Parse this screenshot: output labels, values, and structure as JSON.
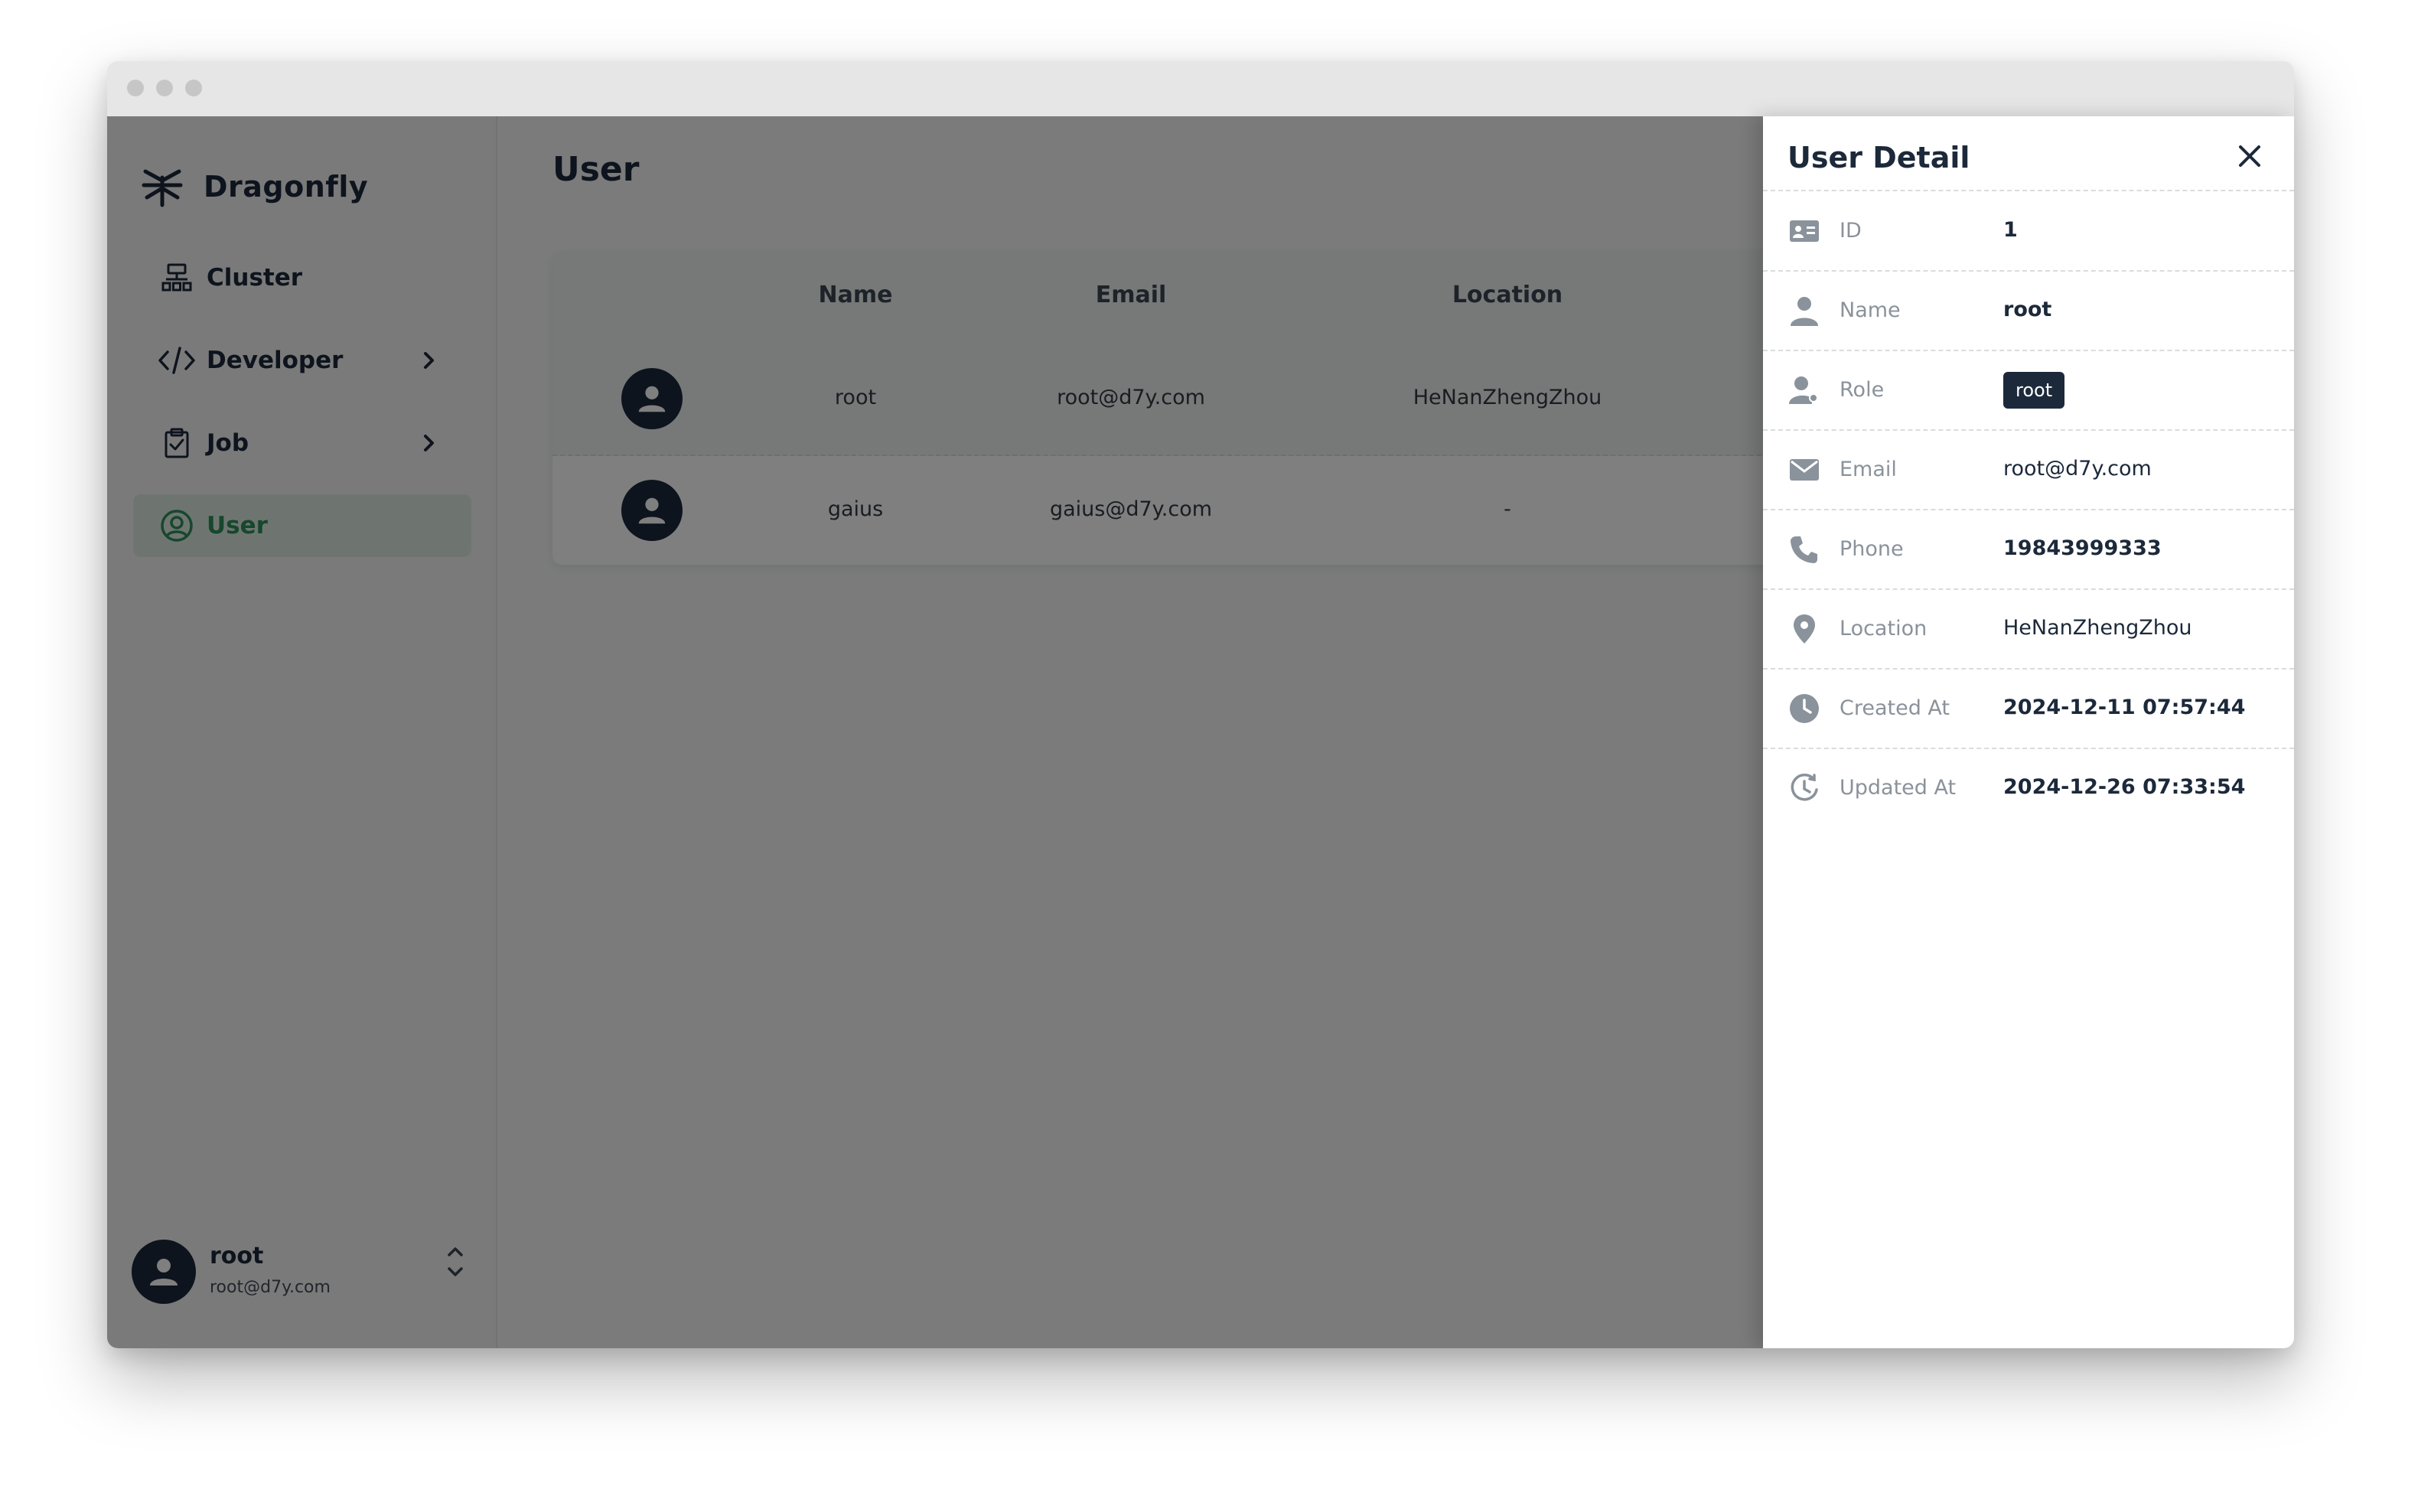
{
  "app": {
    "name": "Dragonfly"
  },
  "sidebar": {
    "items": [
      {
        "label": "Cluster",
        "icon": "cluster-icon",
        "expandable": false,
        "active": false
      },
      {
        "label": "Developer",
        "icon": "code-icon",
        "expandable": true,
        "active": false
      },
      {
        "label": "Job",
        "icon": "clipboard-check-icon",
        "expandable": true,
        "active": false
      },
      {
        "label": "User",
        "icon": "user-circle-icon",
        "expandable": false,
        "active": true
      }
    ],
    "profile": {
      "name": "root",
      "email": "root@d7y.com"
    }
  },
  "main": {
    "title": "User",
    "table": {
      "columns": [
        "Name",
        "Email",
        "Location"
      ],
      "rows": [
        {
          "name": "root",
          "email": "root@d7y.com",
          "location": "HeNanZhengZhou"
        },
        {
          "name": "gaius",
          "email": "gaius@d7y.com",
          "location": "-"
        }
      ]
    }
  },
  "drawer": {
    "title": "User Detail",
    "fields": [
      {
        "label": "ID",
        "value": "1",
        "icon": "id-card-icon"
      },
      {
        "label": "Name",
        "value": "root",
        "icon": "person-icon"
      },
      {
        "label": "Role",
        "value": "root",
        "icon": "user-role-icon"
      },
      {
        "label": "Email",
        "value": "root@d7y.com",
        "icon": "mail-icon"
      },
      {
        "label": "Phone",
        "value": "19843999333",
        "icon": "phone-icon"
      },
      {
        "label": "Location",
        "value": "HeNanZhengZhou",
        "icon": "location-pin-icon"
      },
      {
        "label": "Created At",
        "value": "2024-12-11 07:57:44",
        "icon": "clock-icon"
      },
      {
        "label": "Updated At",
        "value": "2024-12-26 07:33:54",
        "icon": "history-icon"
      }
    ]
  },
  "colors": {
    "accent": "#2e8f5b",
    "active_bg": "#dcebe3",
    "text_dark": "#1c293a",
    "muted": "#8a929b",
    "overlay": "rgba(0,0,0,0.5)"
  }
}
